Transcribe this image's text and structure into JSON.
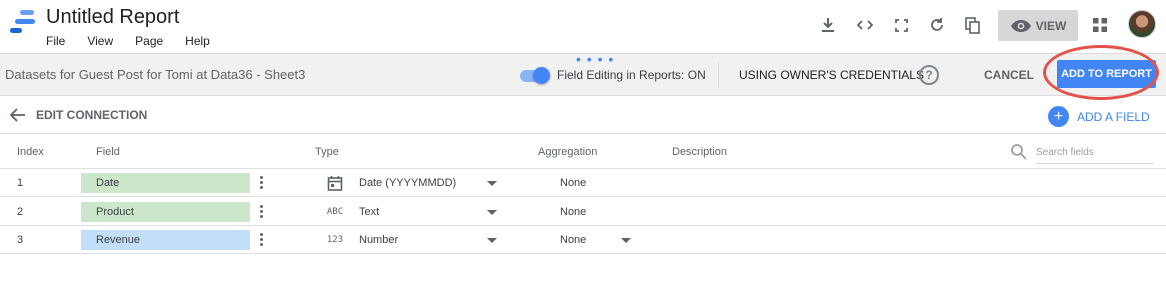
{
  "header": {
    "title": "Untitled Report",
    "menu": [
      "File",
      "View",
      "Page",
      "Help"
    ],
    "view_label": "VIEW",
    "icons": [
      "download-icon",
      "embed-code-icon",
      "fullscreen-icon",
      "refresh-icon",
      "copy-icon",
      "eye-icon",
      "apps-grid-icon"
    ]
  },
  "dataset_bar": {
    "name": "Datasets for Guest Post for Tomi at Data36 - Sheet3",
    "field_editing_label": "Field Editing in Reports: ON",
    "field_editing_on": true,
    "credentials_label": "USING OWNER'S CREDENTIALS",
    "help_glyph": "?",
    "cancel_label": "CANCEL",
    "add_to_report_label": "ADD TO REPORT"
  },
  "edit_connection": {
    "label": "EDIT CONNECTION",
    "add_field_label": "ADD A FIELD"
  },
  "table": {
    "headers": {
      "index": "Index",
      "field": "Field",
      "type": "Type",
      "aggregation": "Aggregation",
      "description": "Description"
    },
    "search_placeholder": "Search fields",
    "rows": [
      {
        "index": "1",
        "field": "Date",
        "type_icon": "calendar-icon",
        "type_glyph": "",
        "type": "Date (YYYYMMDD)",
        "aggregation": "None",
        "role": "dimension"
      },
      {
        "index": "2",
        "field": "Product",
        "type_icon": "text-type-icon",
        "type_glyph": "ABC",
        "type": "Text",
        "aggregation": "None",
        "role": "dimension"
      },
      {
        "index": "3",
        "field": "Revenue",
        "type_icon": "number-type-icon",
        "type_glyph": "123",
        "type": "Number",
        "aggregation": "None",
        "role": "metric"
      }
    ]
  },
  "colors": {
    "accent": "#4285f4",
    "dimension_field": "#cce6cc",
    "metric_field": "#c2dff7",
    "highlight_circle": "#e3534b"
  }
}
